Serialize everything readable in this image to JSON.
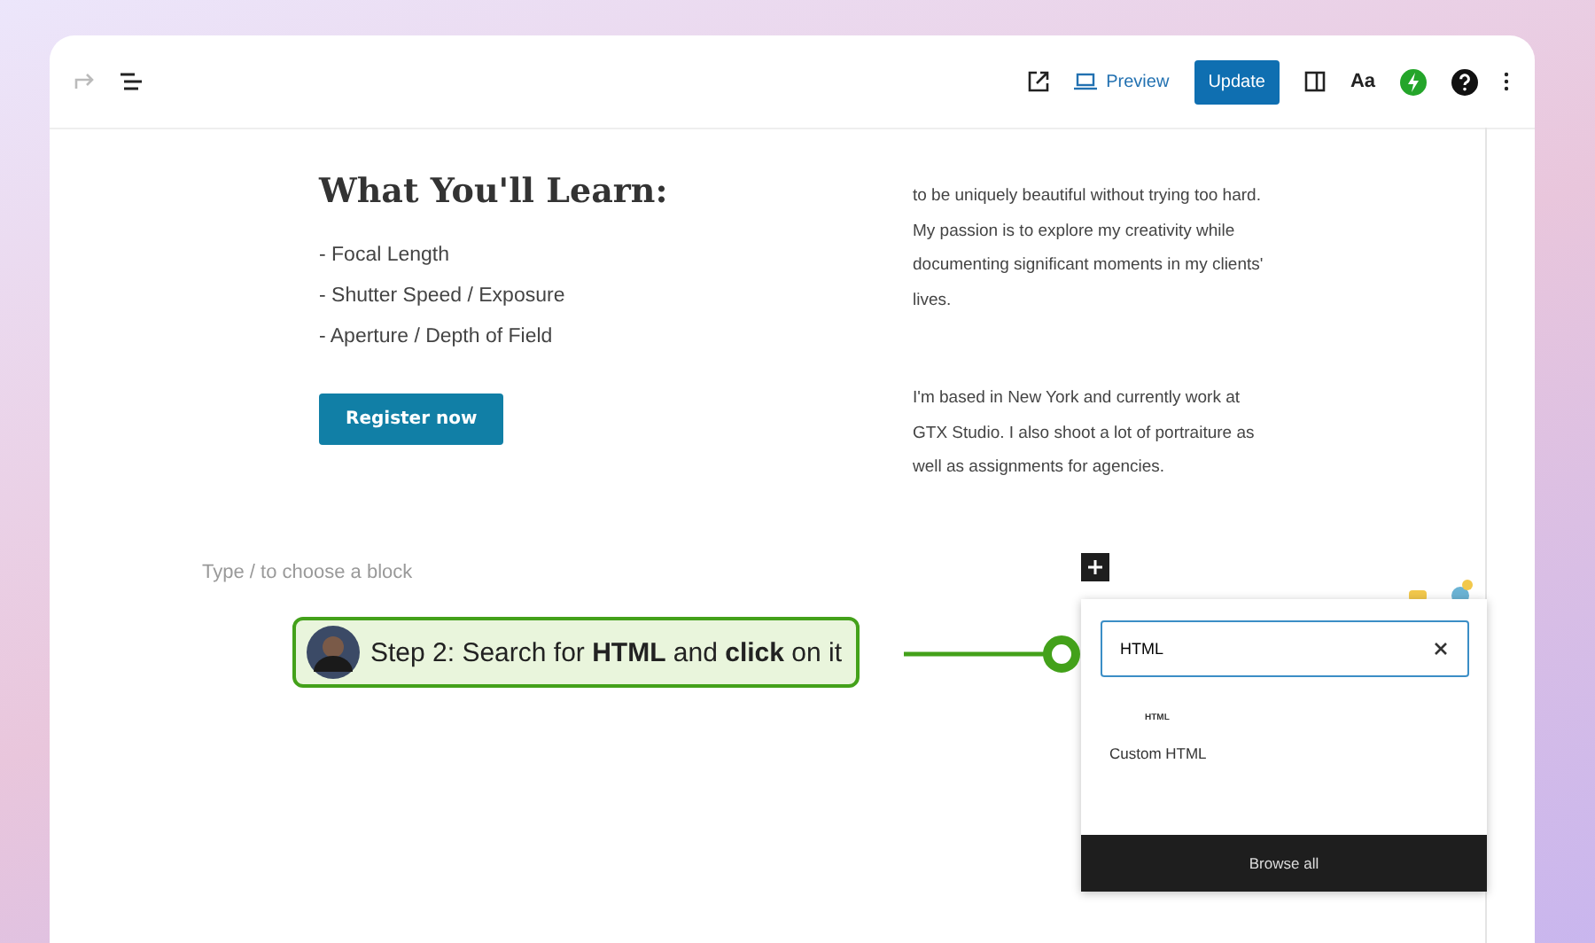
{
  "toolbar": {
    "preview": "Preview",
    "update": "Update",
    "styles": "Aa"
  },
  "content": {
    "heading": "What You'll Learn:",
    "list": [
      "- Focal Length",
      "- Shutter Speed / Exposure",
      "- Aperture / Depth of Field"
    ],
    "button": "Register now",
    "paragraphs": [
      "to be uniquely beautiful without trying too hard. My passion is to explore my creativity while documenting significant moments in my clients' lives.",
      "I'm based in New York and currently work at GTX Studio. I also shoot a lot of portraiture as well as assignments for agencies."
    ],
    "placeholder": "Type / to choose a block"
  },
  "callout": {
    "text": "Step 2: Search for **HTML** and **click** on it"
  },
  "inserter": {
    "search": "HTML",
    "result_icon": "HTML",
    "result_label": "Custom HTML",
    "browse": "Browse all"
  }
}
